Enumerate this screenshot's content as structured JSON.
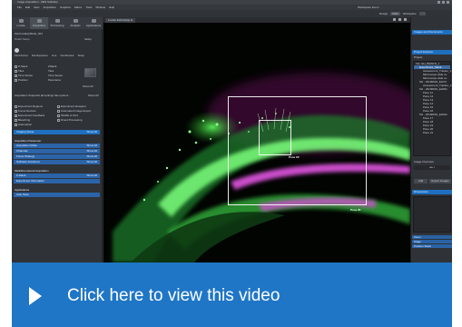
{
  "window": {
    "title": "Image Acquisition - ZEN Software",
    "menus": [
      "File",
      "Edit",
      "View",
      "Acquisition",
      "Graphics",
      "Macro",
      "Tools",
      "Window",
      "Help"
    ],
    "workspace_zoom_label": "Workspace Zoom",
    "workspace_label": "Workspace",
    "design_label": "Design",
    "design_value": "Dark"
  },
  "left_panel": {
    "tabs": [
      "Locate",
      "Acquisition",
      "Processing",
      "Analysis",
      "Applications"
    ],
    "experiment_name": "ZenCoreExpMode_001",
    "smart_setup_label": "Smart Setup",
    "smart_setup_action": "Setup",
    "tool_buttons": [
      "Find Focus",
      "Set Exposure",
      "Live",
      "Continuous",
      "Snap"
    ],
    "channel_checks": [
      "Z-Stack",
      "Tiles",
      "Time Series",
      "Position",
      "Show All"
    ],
    "channel_values": [
      "ZStack",
      "Tiles",
      "Time Series",
      "Panorama"
    ],
    "info_text": "Acquisition Snapshot all settings has options...",
    "info_action": "Show All",
    "checklist_left": [
      "Experiment Regions",
      "Focus Devices",
      "Experiment Feedback",
      "Bleaching",
      "Automation"
    ],
    "checklist_right": [
      "Experiment Designer",
      "Automated Image Export",
      "Shuffle & Find",
      "Direct Processing"
    ],
    "imaging_setup": "Imaging Setup",
    "imaging_setup_action": "Show All",
    "acq_param_title": "Acquisition Parameter",
    "acq_param_rows": [
      "Acquisition Mode",
      "Channels",
      "Focus Strategy",
      "Software Autofocus"
    ],
    "acq_param_action": "Show All",
    "multidim_title": "Multidimensional Acquisition",
    "multidim_rows": [
      "Z-Stack",
      "Experiment Information"
    ],
    "applications_title": "Applications",
    "applications_rows": [
      "Auto Save"
    ]
  },
  "viewer": {
    "tab_label": "Locate EstCatApp E",
    "roi_labels": [
      "Pose CF",
      "Pose 3F"
    ]
  },
  "right_panel": {
    "header": "Images and Documents",
    "files_title": "Project Explorer",
    "project_label": "Project",
    "tree": [
      {
        "label": "File: EH_BRAIN1_1",
        "level": 1,
        "selected": false
      },
      {
        "label": "Experiment_Stack",
        "level": 2,
        "selected": true
      },
      {
        "label": "Assessment_Tracker_1",
        "level": 3,
        "selected": false
      },
      {
        "label": "Microscope slide co",
        "level": 3,
        "selected": false
      },
      {
        "label": "Microscope slide co",
        "level": 3,
        "selected": false
      },
      {
        "label": "SH - 20190601_EH7H",
        "level": 2,
        "selected": false
      },
      {
        "label": "Assessment_Tracker_2",
        "level": 3,
        "selected": false
      },
      {
        "label": "SH - 20190601_EH811",
        "level": 2,
        "selected": false
      },
      {
        "label": "Pane 11",
        "level": 3,
        "selected": false
      },
      {
        "label": "Pane 12",
        "level": 3,
        "selected": false
      },
      {
        "label": "Pane 13",
        "level": 3,
        "selected": false
      },
      {
        "label": "Pane 14",
        "level": 3,
        "selected": false
      },
      {
        "label": "Pane 15",
        "level": 3,
        "selected": false
      },
      {
        "label": "Pane 16",
        "level": 3,
        "selected": false
      },
      {
        "label": "SH - 20190601_EH911",
        "level": 2,
        "selected": false
      },
      {
        "label": "Pane 17",
        "level": 3,
        "selected": false
      },
      {
        "label": "Pane 18",
        "level": 3,
        "selected": false
      },
      {
        "label": "Pane 19",
        "level": 3,
        "selected": false
      },
      {
        "label": "Pane 20",
        "level": 3,
        "selected": false
      },
      {
        "label": "Pane 21",
        "level": 3,
        "selected": false
      }
    ],
    "image_overview_label": "Image Overview",
    "add_button": "Add",
    "export_button": "Export Images",
    "bottom_title": "Dimensions",
    "bottom_rows": [
      "Zoom",
      "Stage",
      "Position Stack"
    ]
  },
  "video": {
    "label": "Click here to view this video"
  }
}
